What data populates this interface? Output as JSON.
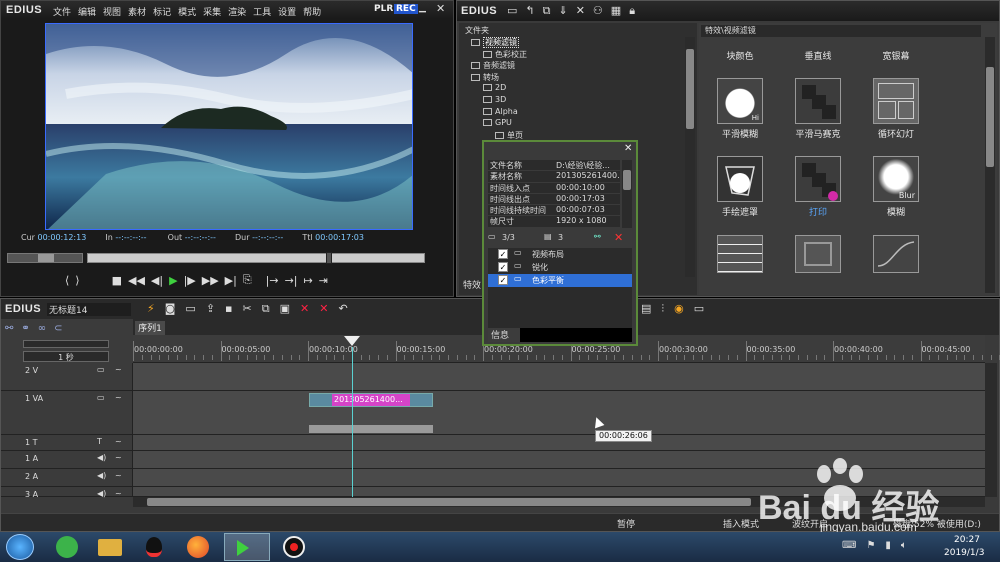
{
  "player": {
    "logo": "EDIUS",
    "menu": [
      "文件",
      "编辑",
      "视图",
      "素材",
      "标记",
      "模式",
      "采集",
      "渲染",
      "工具",
      "设置",
      "帮助"
    ],
    "plr": "PLR",
    "rec": "REC",
    "cur_label": "Cur",
    "cur_value": "00:00:12:13",
    "in_label": "In",
    "in_value": "--:--:--:--",
    "out_label": "Out",
    "out_value": "--:--:--:--",
    "dur_label": "Dur",
    "dur_value": "--:--:--:--",
    "ttl_label": "Ttl",
    "ttl_value": "00:00:17:03"
  },
  "bin": {
    "logo": "EDIUS",
    "folder_header": "文件夹",
    "tree": [
      {
        "label": "视频滤镜",
        "level": 1,
        "selected": true
      },
      {
        "label": "色彩校正",
        "level": 2
      },
      {
        "label": "音频滤镜",
        "level": 1
      },
      {
        "label": "转场",
        "level": 1
      },
      {
        "label": "2D",
        "level": 2
      },
      {
        "label": "3D",
        "level": 2
      },
      {
        "label": "Alpha",
        "level": 2
      },
      {
        "label": "GPU",
        "level": 2
      },
      {
        "label": "单页",
        "level": 3
      }
    ],
    "path": "特效\\视频滤镜",
    "effects_row1": [
      "块颜色",
      "垂直线",
      "宽银幕"
    ],
    "effects_row2": [
      "平滑模糊",
      "平滑马赛克",
      "循环幻灯"
    ],
    "effects_row3": [
      "手绘遮罩",
      "打印",
      "模糊"
    ],
    "tile_hi": "Hi",
    "tile_blur": "Blur",
    "bottom_tab": "特效"
  },
  "info_popup": {
    "rows": [
      {
        "k": "文件名称",
        "v": "D:\\经验\\经验..."
      },
      {
        "k": "素材名称",
        "v": "201305261400..."
      },
      {
        "k": "时间线入点",
        "v": "00:00:10:00"
      },
      {
        "k": "时间线出点",
        "v": "00:00:17:03"
      },
      {
        "k": "时间线持续时间",
        "v": "00:00:07:03"
      },
      {
        "k": "帧尺寸",
        "v": "1920 x 1080"
      }
    ],
    "count1": "3/3",
    "count2": "3",
    "filters": [
      {
        "label": "视频布局",
        "selected": false
      },
      {
        "label": "锐化",
        "selected": false
      },
      {
        "label": "色彩平衡",
        "selected": true
      }
    ],
    "tab": "信息"
  },
  "timeline": {
    "logo": "EDIUS",
    "project_name": "无标题14",
    "sequence_tab": "序列1",
    "zoom": "1 秒",
    "ruler": [
      "00:00:00:00",
      "00:00:05:00",
      "00:00:10:00",
      "00:00:15:00",
      "00:00:20:00",
      "00:00:25:00",
      "00:00:30:00",
      "00:00:35:00",
      "00:00:40:00",
      "00:00:45:00"
    ],
    "tracks": [
      "2 V",
      "1 VA",
      "1 T",
      "1 A",
      "2 A",
      "3 A"
    ],
    "clip_label": "201305261400...",
    "tooltip": "00:00:26:06"
  },
  "statusbar": {
    "status1": "暂停",
    "status2": "插入模式",
    "status3": "波纹开启",
    "status4": "磁盘:52% 被使用(D:)"
  },
  "taskbar": {
    "time": "20:27",
    "date": "2019/1/3"
  },
  "watermark": {
    "brand": "Bai du 经验",
    "url": "jingyan.baidu.com"
  }
}
